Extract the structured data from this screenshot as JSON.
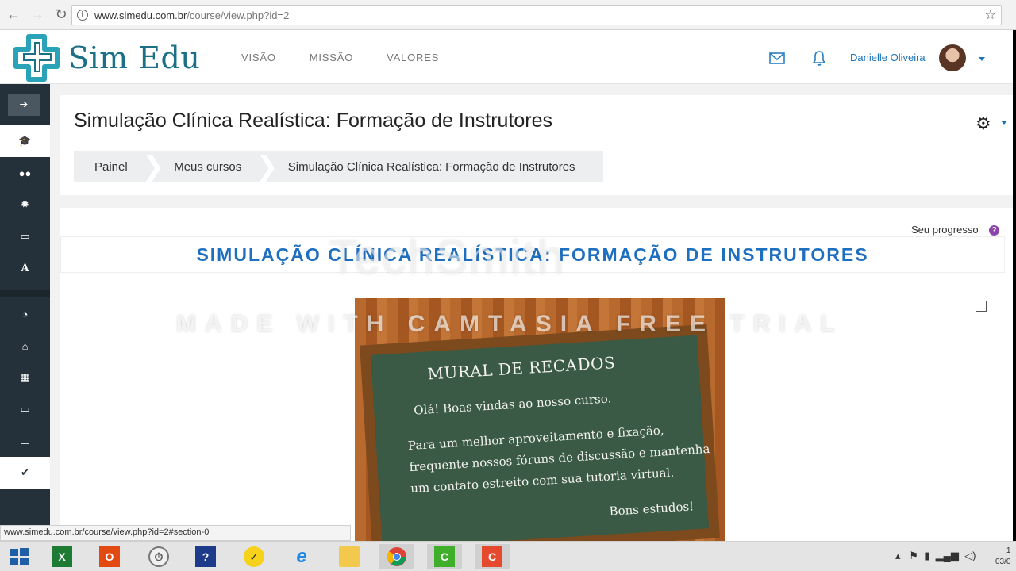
{
  "browser": {
    "url_host": "www.simedu.com.br",
    "url_path": "/course/view.php?id=2"
  },
  "site": {
    "brand": "Sim Edu",
    "nav": [
      "VISÃO",
      "MISSÃO",
      "VALORES"
    ],
    "user_name": "Danielle Oliveira"
  },
  "page": {
    "title": "Simulação Clínica Realística: Formação de Instrutores",
    "breadcrumb": [
      "Painel",
      "Meus cursos",
      "Simulação Clínica Realística: Formação de Instrutores"
    ]
  },
  "content": {
    "progress_label": "Seu progresso",
    "section_title": "SIMULAÇÃO CLÍNICA REALÍSTICA: FORMAÇÃO DE INSTRUTORES",
    "mural": {
      "title": "MURAL DE RECADOS",
      "greeting": "Olá! Boas vindas ao nosso curso.",
      "body": "Para um melhor aproveitamento e fixação, frequente nossos fóruns de discussão e mantenha um contato estreito com sua tutoria virtual.",
      "closing": "Bons estudos!"
    }
  },
  "watermark": {
    "brand": "TechSmith",
    "notice": "MADE WITH CAMTASIA FREE TRIAL"
  },
  "statusbar": {
    "link": "www.simedu.com.br/course/view.php?id=2#section-0"
  },
  "taskbar": {
    "clock_time": "1",
    "clock_date": "03/0"
  },
  "colors": {
    "brand": "#1b6f86",
    "link": "#1a73b8",
    "drawer": "#25313a",
    "section_title": "#1e6fbf"
  }
}
